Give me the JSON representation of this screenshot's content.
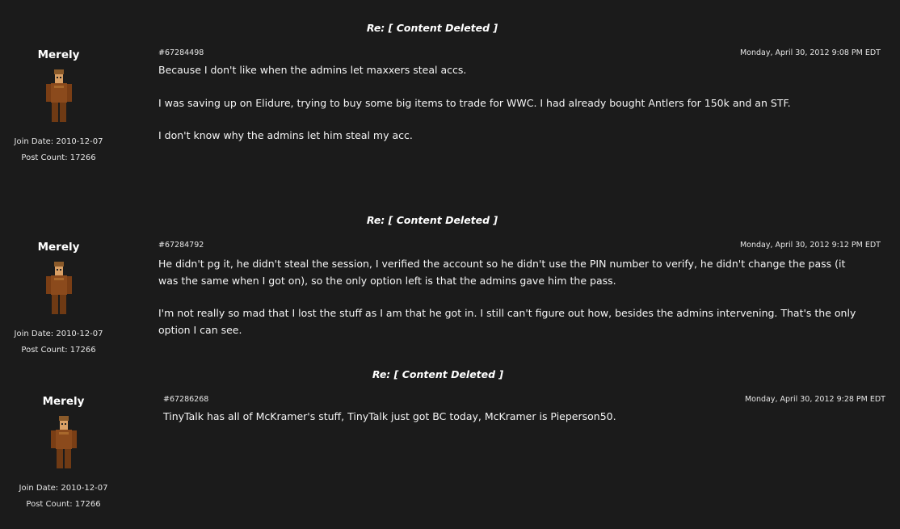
{
  "posts": [
    {
      "title": "Re: [ Content Deleted ]",
      "author": "Merely",
      "join_date": "Join Date: 2010-12-07",
      "post_count": "Post Count: 17266",
      "post_id": "#67284498",
      "date": "Monday, April 30, 2012 9:08 PM EDT",
      "paragraphs": [
        "Because I don't like when the admins let maxxers steal accs.",
        "I was saving up on Elidure, trying to buy some big items to trade for WWC. I had already bought Antlers for 150k and an STF.",
        "I don't know why the admins let him steal my acc."
      ]
    },
    {
      "title": "Re: [ Content Deleted ]",
      "author": "Merely",
      "join_date": "Join Date: 2010-12-07",
      "post_count": "Post Count: 17266",
      "post_id": "#67284792",
      "date": "Monday, April 30, 2012 9:12 PM EDT",
      "paragraphs": [
        "He didn't pg it, he didn't steal the session, I verified the account so he didn't use the PIN number to verify, he didn't change the pass (it was the same when I got on), so the only option left is that the admins gave him the pass.",
        "I'm not really so mad that I lost the stuff as I am that he got in. I still can't figure out how, besides the admins intervening. That's the only option I can see."
      ]
    },
    {
      "title": "Re: [ Content Deleted ]",
      "author": "Merely",
      "join_date": "Join Date: 2010-12-07",
      "post_count": "Post Count: 17266",
      "post_id": "#67286268",
      "date": "Monday, April 30, 2012 9:28 PM EDT",
      "paragraphs": [
        "TinyTalk has all of McKramer's stuff, TinyTalk just got BC today, McKramer is Pieperson50."
      ]
    }
  ]
}
